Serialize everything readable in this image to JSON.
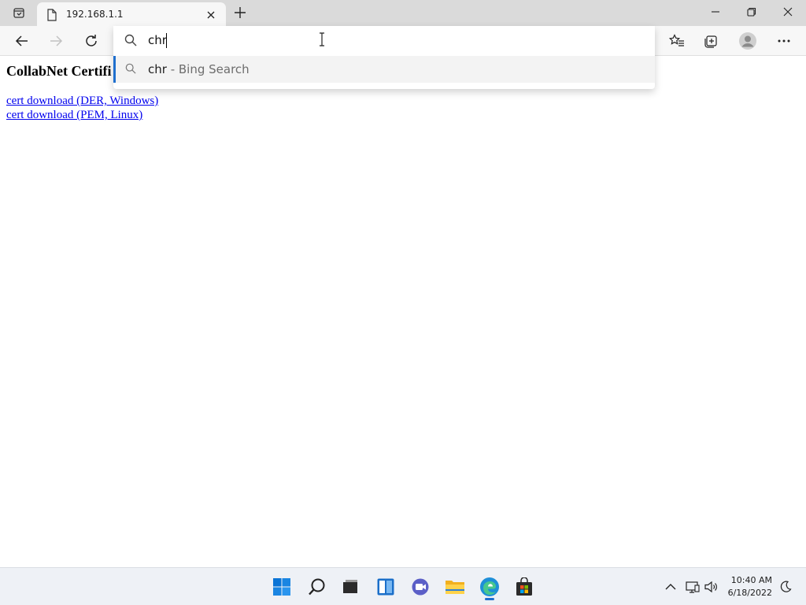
{
  "browser": {
    "tab": {
      "title": "192.168.1.1"
    },
    "omnibox": {
      "query": "chr",
      "suggestion": {
        "query": "chr",
        "provider_suffix": " - Bing Search"
      }
    }
  },
  "page": {
    "heading": "CollabNet Certifi",
    "links": [
      "cert download (DER, Windows)",
      "cert download (PEM, Linux)"
    ]
  },
  "taskbar": {
    "time": "10:40 AM",
    "date": "6/18/2022"
  },
  "colors": {
    "accent": "#1f6fce",
    "link": "#0000ee",
    "tabstrip": "#dadada",
    "toolbar": "#f7f7f7",
    "taskbar": "#eef1f6"
  },
  "icons": [
    "tab-actions-icon",
    "page-icon",
    "close-icon",
    "plus-icon",
    "minimize-icon",
    "restore-icon",
    "window-close-icon",
    "back-icon",
    "forward-icon",
    "refresh-icon",
    "favorites-icon",
    "collections-icon",
    "profile-icon",
    "more-icon",
    "search-icon",
    "text-cursor-icon",
    "windows-start-icon",
    "taskbar-search-icon",
    "task-view-icon",
    "widgets-icon",
    "chat-icon",
    "file-explorer-icon",
    "edge-icon",
    "store-icon",
    "chevron-up-icon",
    "network-icon",
    "volume-icon",
    "notification-icon"
  ]
}
